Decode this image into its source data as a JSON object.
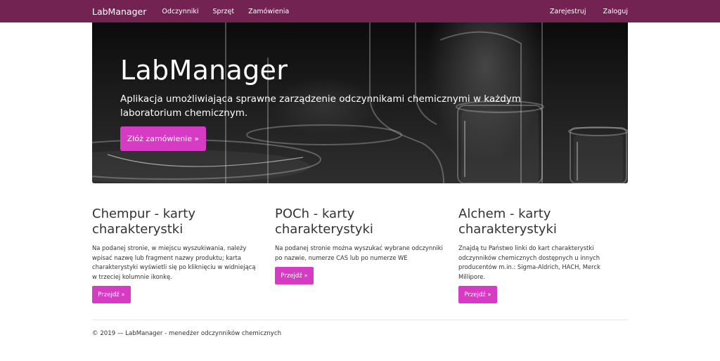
{
  "navbar": {
    "brand": "LabManager",
    "links": [
      "Odczynniki",
      "Sprzęt",
      "Zamówienia"
    ],
    "right_links": [
      "Zarejestruj",
      "Zaloguj"
    ]
  },
  "hero": {
    "title": "LabManager",
    "text": "Aplikacja umożliwiająca sprawne zarządzenie odczynnikami chemicznymi w każdym laboratorium chemicznym.",
    "button_label": "Złóż zamówienie »"
  },
  "columns": [
    {
      "title": "Chempur - karty charakterystki",
      "text": "Na podanej stronie, w miejscu wyszukiwania, należy wpisać nazwę lub fragment nazwy produktu; karta charakterystyki wyświetli się po kliknięciu w widniejącą w trzeciej kolumnie ikonkę.",
      "button_label": "Przejdź »"
    },
    {
      "title": "POCh - karty charakterystyki",
      "text": "Na podanej stronie można wyszukać wybrane odczynniki po nazwie, numerze CAS lub po numerze WE",
      "button_label": "Przejdź »"
    },
    {
      "title": "Alchem - karty charakterystyki",
      "text": "Znajdą tu Państwo linki do kart charakterystki odczynników chemicznych dostępnych u innych producentów m.in.: Sigma-Aldrich, HACH, Merck Millipore.",
      "button_label": "Przejdź »"
    }
  ],
  "footer": {
    "text": "© 2019 — LabManager - menedżer odczynników chemicznych"
  },
  "colors": {
    "navbar": "#722352",
    "accent": "#d63bc4"
  }
}
